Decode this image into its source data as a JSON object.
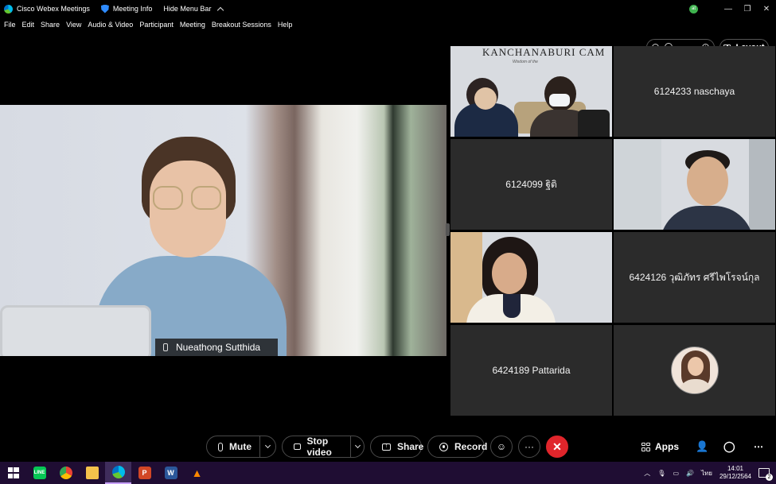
{
  "titlebar": {
    "app_title": "Cisco Webex Meetings",
    "meeting_info": "Meeting Info",
    "hide_menu": "Hide Menu Bar",
    "user_initials": "at"
  },
  "menu": [
    "File",
    "Edit",
    "Share",
    "View",
    "Audio & Video",
    "Participant",
    "Meeting",
    "Breakout Sessions",
    "Help"
  ],
  "active_speaker": {
    "name": "Nueathong Sutthida"
  },
  "layout_button": {
    "label": "Layout"
  },
  "tiles": [
    {
      "type": "video",
      "sign": "KANCHANABURI CAM",
      "sign_sub": "Wisdom of the"
    },
    {
      "type": "name",
      "label": "6124233 naschaya"
    },
    {
      "type": "name",
      "label": "6124099 ฐิติ"
    },
    {
      "type": "video"
    },
    {
      "type": "video"
    },
    {
      "type": "name",
      "label": "6424126 วุฒิภัทร ศรีไพโรจน์กุล"
    },
    {
      "type": "name",
      "label": "6424189 Pattarida"
    },
    {
      "type": "avatar"
    }
  ],
  "controls": {
    "mute": "Mute",
    "stop_video": "Stop video",
    "share": "Share",
    "record": "Record",
    "more": "···",
    "end": "✕",
    "apps": "Apps"
  },
  "taskbar": {
    "apps": [
      "LINE",
      "Chrome",
      "File Explorer",
      "Webex",
      "PowerPoint",
      "Word",
      "VLC"
    ],
    "language": "ไทย",
    "time": "14:01",
    "date": "29/12/2564",
    "notification_count": "2"
  },
  "colors": {
    "end_call": "#e0252b",
    "taskbar": "#1f0d33",
    "tile_bg": "#2b2b2b"
  }
}
